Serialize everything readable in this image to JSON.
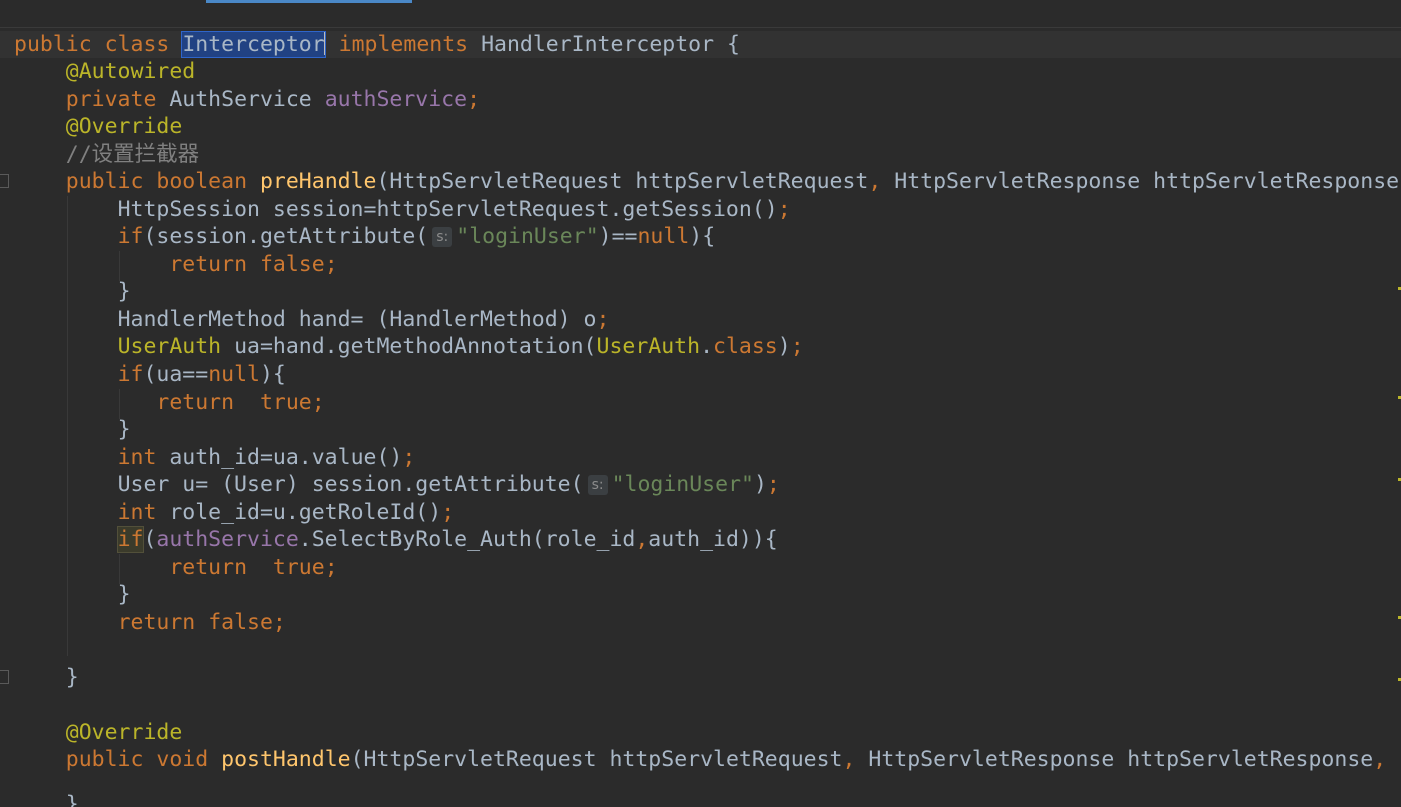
{
  "editor": {
    "line1": {
      "kw1": "public",
      "kw2": "class",
      "class_name": "Interceptor",
      "kw3": "implements",
      "iface": "HandlerInterceptor",
      "brace": "{"
    },
    "line2": {
      "annotation": "@Autowired"
    },
    "line3": {
      "kw": "private",
      "type": "AuthService",
      "field": "authService",
      "semi": ";"
    },
    "line4": {
      "annotation": "@Override"
    },
    "line5": {
      "comment": "//设置拦截器"
    },
    "line6": {
      "kw1": "public",
      "kw2": "boolean",
      "method": "preHandle",
      "params_a": "(HttpServletRequest httpServletRequest",
      "comma": ",",
      "params_b": " HttpServletResponse httpServletResponse"
    },
    "line7": {
      "code": "HttpSession session=httpServletRequest.getSession()",
      "semi": ";"
    },
    "line8": {
      "kw": "if",
      "code_a": "(session.getAttribute(",
      "hint": "s:",
      "str": "\"loginUser\"",
      "code_b": ")==",
      "null": "null",
      "code_c": "){"
    },
    "line9": {
      "kw1": "return",
      "kw2": "false",
      "semi": ";"
    },
    "line10": {
      "code": "}"
    },
    "line11": {
      "code": "HandlerMethod hand= (HandlerMethod) o",
      "semi": ";"
    },
    "line12": {
      "anntype": "UserAuth",
      "code_a": " ua=hand.getMethodAnnotation(",
      "anntype2": "UserAuth",
      "dot": ".",
      "kw": "class",
      "code_b": ")",
      "semi": ";"
    },
    "line13": {
      "kw": "if",
      "code_a": "(ua==",
      "null": "null",
      "code_b": "){"
    },
    "line14": {
      "kw1": "return",
      "kw2": "true",
      "semi": ";"
    },
    "line15": {
      "code": "}"
    },
    "line16": {
      "kw": "int",
      "code": " auth_id=ua.value()",
      "semi": ";"
    },
    "line17": {
      "code_a": "User u= (User) session.getAttribute(",
      "hint": "s:",
      "str": "\"loginUser\"",
      "code_b": ")",
      "semi": ";"
    },
    "line18": {
      "kw": "int",
      "code": " role_id=u.getRoleId()",
      "semi": ";"
    },
    "line19": {
      "kw": "if",
      "code_a": "(",
      "field": "authService",
      "code_b": ".SelectByRole_Auth(role_id",
      "comma": ",",
      "code_c": "auth_id)){"
    },
    "line20": {
      "kw1": "return",
      "kw2": "true",
      "semi": ";"
    },
    "line21": {
      "code": "}"
    },
    "line22": {
      "kw1": "return",
      "kw2": "false",
      "semi": ";"
    },
    "line24": {
      "code": "}"
    },
    "line26": {
      "annotation": "@Override"
    },
    "line27": {
      "kw1": "public",
      "kw2": "void",
      "method": "postHandle",
      "params_a": "(HttpServletRequest httpServletRequest",
      "comma1": ",",
      "params_b": " HttpServletResponse httpServletResponse",
      "comma2": ","
    },
    "line28": {
      "code": "}"
    }
  },
  "colors": {
    "background": "#2b2b2b",
    "keyword": "#cc7832",
    "annotation": "#bbb529",
    "field": "#9876aa",
    "method": "#ffc66d",
    "string": "#6a8759",
    "comment": "#808080",
    "text": "#a9b7c6",
    "selection": "#214283"
  }
}
